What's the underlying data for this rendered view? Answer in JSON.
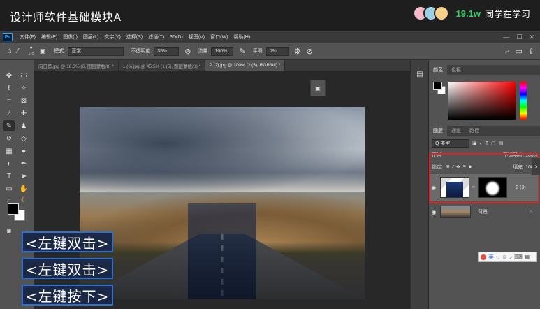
{
  "course": {
    "title": "设计师软件基础模块A",
    "viewer_count": "19.1w",
    "viewer_label": "同学在学习"
  },
  "menu": {
    "items": [
      "文件(F)",
      "编辑(E)",
      "图像(I)",
      "图层(L)",
      "文字(Y)",
      "选择(S)",
      "滤镜(T)",
      "3D(D)",
      "视图(V)",
      "窗口(W)",
      "帮助(H)"
    ],
    "win_controls": [
      "—",
      "☐",
      "✕"
    ]
  },
  "options": {
    "brush_size": "175",
    "mode_label": "模式:",
    "mode_value": "正常",
    "opacity_label": "不透明度:",
    "opacity_value": "35%",
    "flow_label": "流量:",
    "flow_value": "100%",
    "smooth_label": "平滑:",
    "smooth_value": "0%"
  },
  "tabs": [
    "向日葵.jpg @ 18.3% (6, 图层蒙版/8) *",
    "1 (6).jpg @ 45.5% (1 (5), 图层蒙版/8) *",
    "2 (2).jpg @ 100% (2 (3), RGB/8#) *"
  ],
  "hints": [
    "<左键双击>",
    "<左键双击>",
    "<左键按下>"
  ],
  "color_panel": {
    "tabs": [
      "颜色",
      "色板"
    ]
  },
  "layers_panel": {
    "tabs": [
      "图层",
      "通道",
      "路径"
    ],
    "filter_label": "Q 类型",
    "blend_mode": "正常",
    "opacity_label": "不透明度:",
    "opacity_value": "100%",
    "lock_label": "锁定:",
    "fill_label": "填充:",
    "fill_value": "100%",
    "layers": [
      {
        "name": "2 (3)"
      },
      {
        "name": "背景"
      }
    ]
  },
  "ime": {
    "label": "英"
  }
}
